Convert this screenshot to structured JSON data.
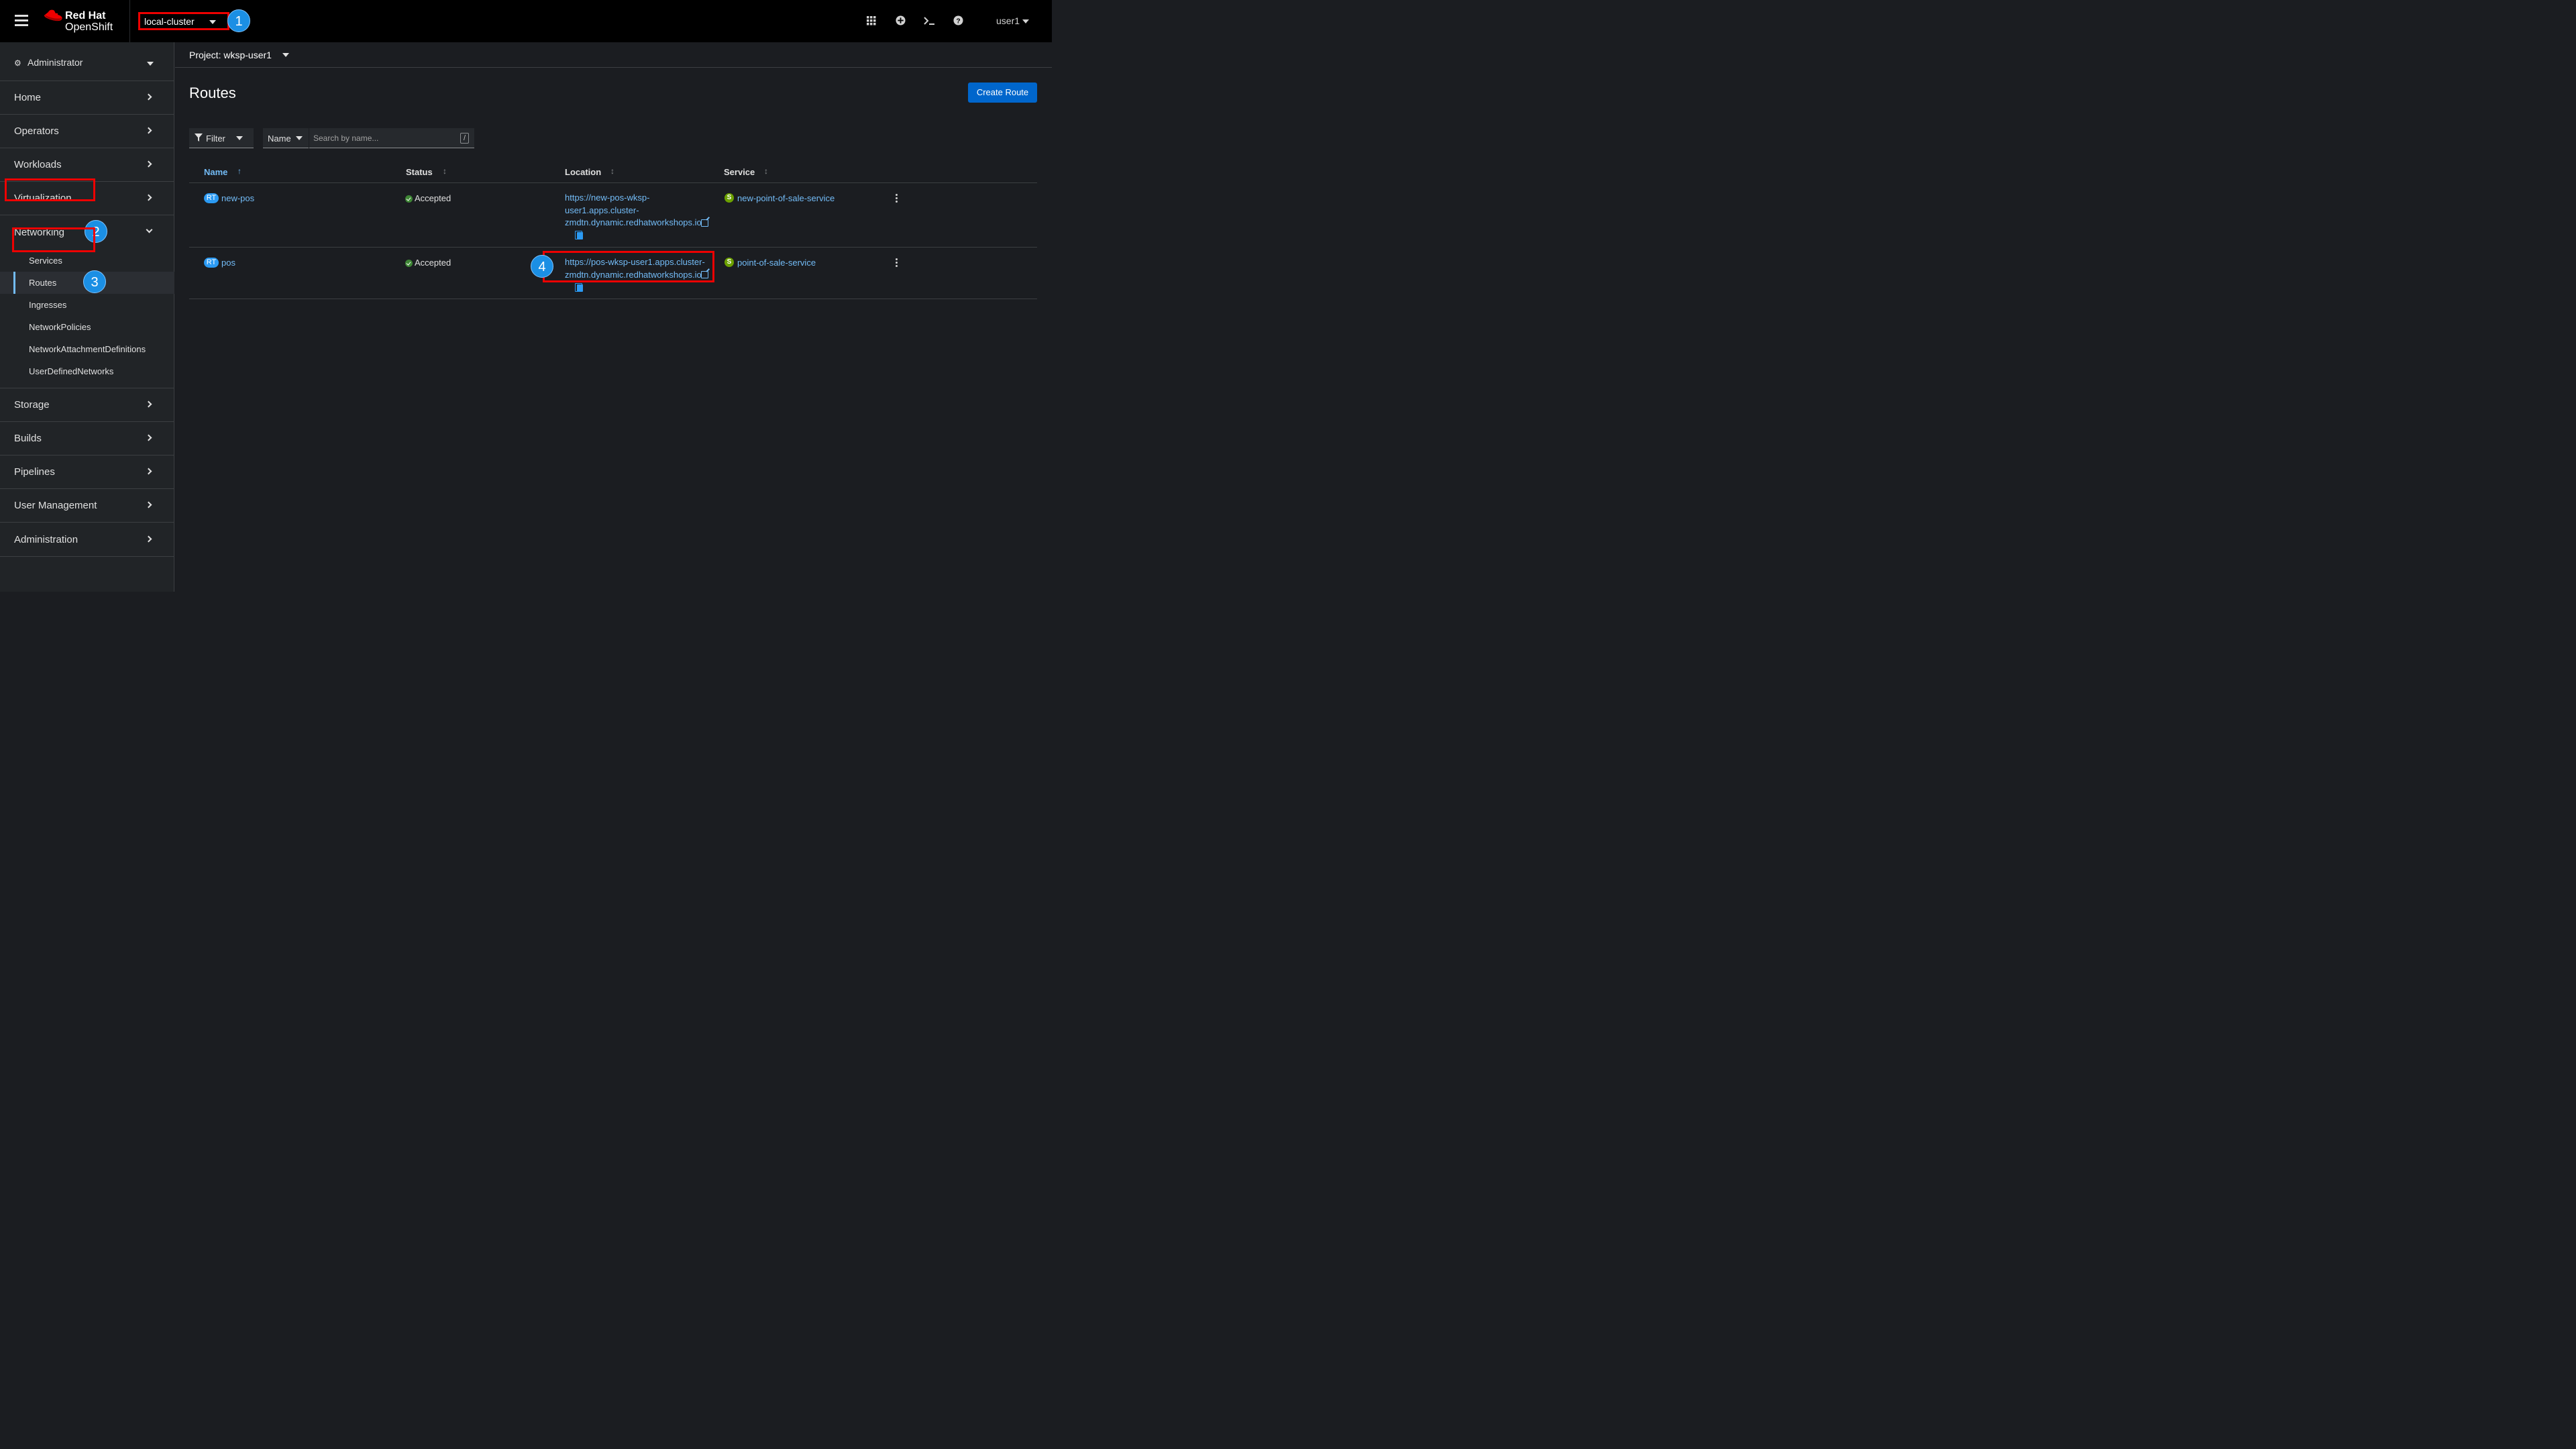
{
  "masthead": {
    "brand_line1": "Red Hat",
    "brand_line2": "OpenShift",
    "cluster": "local-cluster",
    "user": "user1",
    "icons": [
      "grid-icon",
      "plus-circle-icon",
      "terminal-icon",
      "help-icon"
    ]
  },
  "annotations": {
    "b1": "1",
    "b2": "2",
    "b3": "3",
    "b4": "4"
  },
  "sidebar": {
    "perspective": "Administrator",
    "items": {
      "home": "Home",
      "operators": "Operators",
      "workloads": "Workloads",
      "virtualization": "Virtualization",
      "networking": "Networking",
      "storage": "Storage",
      "builds": "Builds",
      "pipelines": "Pipelines",
      "user_management": "User Management",
      "administration": "Administration"
    },
    "networking_sub": {
      "services": "Services",
      "routes": "Routes",
      "ingresses": "Ingresses",
      "network_policies": "NetworkPolicies",
      "nads": "NetworkAttachmentDefinitions",
      "udn": "UserDefinedNetworks"
    }
  },
  "project": {
    "label": "Project: wksp-user1"
  },
  "page": {
    "title": "Routes",
    "create_button": "Create Route"
  },
  "toolbar": {
    "filter": "Filter",
    "name_select": "Name",
    "search_placeholder": "Search by name...",
    "shortcut": "/"
  },
  "table": {
    "headers": {
      "name": "Name",
      "status": "Status",
      "location": "Location",
      "service": "Service"
    },
    "rows": [
      {
        "badge": "RT",
        "name": "new-pos",
        "status": "Accepted",
        "location_l1": "https://new-pos-wksp-",
        "location_l2": "user1.apps.cluster-",
        "location_l3": "zmdtn.dynamic.redhatworkshops.io",
        "service_badge": "S",
        "service": "new-point-of-sale-service"
      },
      {
        "badge": "RT",
        "name": "pos",
        "status": "Accepted",
        "location_l1": "https://pos-wksp-user1.apps.cluster-",
        "location_l2": "zmdtn.dynamic.redhatworkshops.io",
        "service_badge": "S",
        "service": "point-of-sale-service"
      }
    ]
  },
  "colors": {
    "accent_link": "#73bcf7",
    "primary_button": "#0066cc",
    "highlight": "#ee0000",
    "badge": "#1b8fe4",
    "success": "#3e8635",
    "service_badge": "#6ca100"
  }
}
